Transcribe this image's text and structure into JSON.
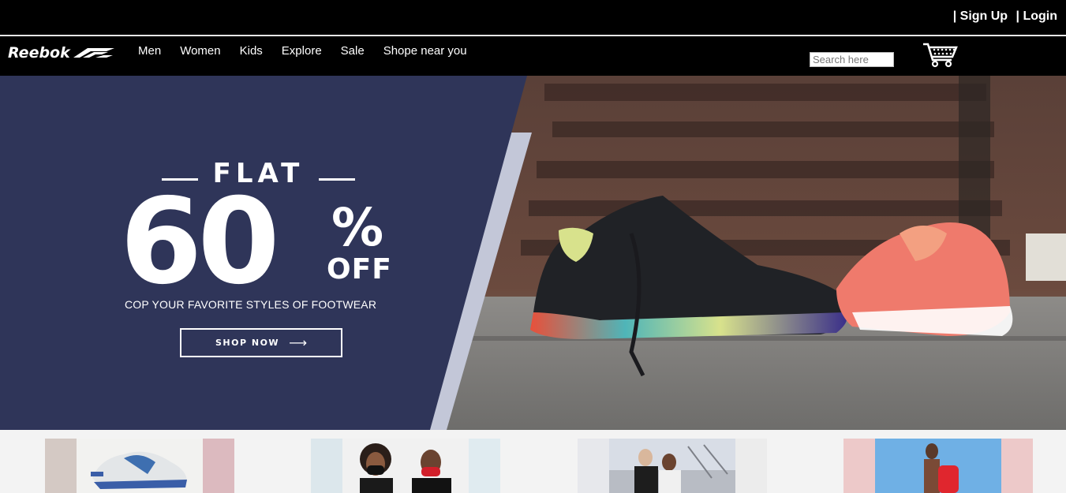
{
  "header": {
    "sign_up": "| Sign Up",
    "login": "| Login"
  },
  "nav": {
    "logo_text": "Reebok",
    "items": [
      "Men",
      "Women",
      "Kids",
      "Explore",
      "Sale",
      "Shope near you"
    ],
    "search_placeholder": "Search here",
    "cart_icon": "shopping-cart-icon"
  },
  "hero": {
    "flat": "FLAT",
    "percent_number": "60",
    "percent_sign": "%",
    "off": "OFF",
    "tagline": "COP YOUR FAVORITE STYLES OF FOOTWEAR",
    "cta": "SHOP NOW",
    "cta_arrow": "⟶",
    "colors": {
      "panel": "#2f3559",
      "text": "#ffffff"
    }
  },
  "cards": [
    {
      "name": "shoe-card"
    },
    {
      "name": "masks-card"
    },
    {
      "name": "apparel-card"
    },
    {
      "name": "backpack-card"
    }
  ]
}
